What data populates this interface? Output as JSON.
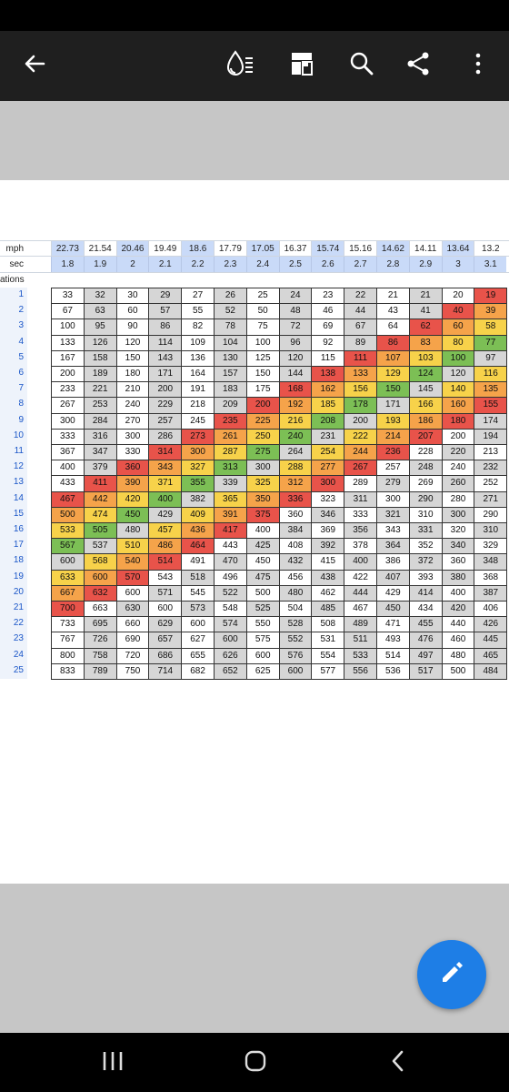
{
  "app": {
    "toolbar": {
      "back_icon": "arrow-left-icon",
      "icons": [
        "ink-dropper-icon",
        "page-layout-icon",
        "search-icon",
        "share-icon",
        "more-vert-icon"
      ]
    },
    "fab_icon": "pencil-icon",
    "nav": [
      "recent-apps-icon",
      "home-icon",
      "back-chevron-icon"
    ]
  },
  "sheet": {
    "label_mph": "mph",
    "label_sec": "sec",
    "label_rows": "ations",
    "mph": [
      "22.73",
      "21.54",
      "20.46",
      "19.49",
      "18.6",
      "17.79",
      "17.05",
      "16.37",
      "15.74",
      "15.16",
      "14.62",
      "14.11",
      "13.64",
      "13.2"
    ],
    "sec": [
      "1.8",
      "1.9",
      "2",
      "2.1",
      "2.2",
      "2.3",
      "2.4",
      "2.5",
      "2.6",
      "2.7",
      "2.8",
      "2.9",
      "3",
      "3.1"
    ],
    "row_numbers": [
      "1",
      "2",
      "3",
      "4",
      "5",
      "6",
      "7",
      "8",
      "9",
      "10",
      "11",
      "12",
      "13",
      "14",
      "15",
      "16",
      "17",
      "18",
      "19",
      "20",
      "21",
      "22",
      "23",
      "24",
      "25"
    ],
    "rows": [
      [
        "33",
        "32",
        "30",
        "29",
        "27",
        "26",
        "25",
        "24",
        "23",
        "22",
        "21",
        "21",
        "20",
        "19"
      ],
      [
        "67",
        "63",
        "60",
        "57",
        "55",
        "52",
        "50",
        "48",
        "46",
        "44",
        "43",
        "41",
        "40",
        "39"
      ],
      [
        "100",
        "95",
        "90",
        "86",
        "82",
        "78",
        "75",
        "72",
        "69",
        "67",
        "64",
        "62",
        "60",
        "58"
      ],
      [
        "133",
        "126",
        "120",
        "114",
        "109",
        "104",
        "100",
        "96",
        "92",
        "89",
        "86",
        "83",
        "80",
        "77"
      ],
      [
        "167",
        "158",
        "150",
        "143",
        "136",
        "130",
        "125",
        "120",
        "115",
        "111",
        "107",
        "103",
        "100",
        "97"
      ],
      [
        "200",
        "189",
        "180",
        "171",
        "164",
        "157",
        "150",
        "144",
        "138",
        "133",
        "129",
        "124",
        "120",
        "116"
      ],
      [
        "233",
        "221",
        "210",
        "200",
        "191",
        "183",
        "175",
        "168",
        "162",
        "156",
        "150",
        "145",
        "140",
        "135"
      ],
      [
        "267",
        "253",
        "240",
        "229",
        "218",
        "209",
        "200",
        "192",
        "185",
        "178",
        "171",
        "166",
        "160",
        "155"
      ],
      [
        "300",
        "284",
        "270",
        "257",
        "245",
        "235",
        "225",
        "216",
        "208",
        "200",
        "193",
        "186",
        "180",
        "174"
      ],
      [
        "333",
        "316",
        "300",
        "286",
        "273",
        "261",
        "250",
        "240",
        "231",
        "222",
        "214",
        "207",
        "200",
        "194"
      ],
      [
        "367",
        "347",
        "330",
        "314",
        "300",
        "287",
        "275",
        "264",
        "254",
        "244",
        "236",
        "228",
        "220",
        "213"
      ],
      [
        "400",
        "379",
        "360",
        "343",
        "327",
        "313",
        "300",
        "288",
        "277",
        "267",
        "257",
        "248",
        "240",
        "232"
      ],
      [
        "433",
        "411",
        "390",
        "371",
        "355",
        "339",
        "325",
        "312",
        "300",
        "289",
        "279",
        "269",
        "260",
        "252"
      ],
      [
        "467",
        "442",
        "420",
        "400",
        "382",
        "365",
        "350",
        "336",
        "323",
        "311",
        "300",
        "290",
        "280",
        "271"
      ],
      [
        "500",
        "474",
        "450",
        "429",
        "409",
        "391",
        "375",
        "360",
        "346",
        "333",
        "321",
        "310",
        "300",
        "290"
      ],
      [
        "533",
        "505",
        "480",
        "457",
        "436",
        "417",
        "400",
        "384",
        "369",
        "356",
        "343",
        "331",
        "320",
        "310"
      ],
      [
        "567",
        "537",
        "510",
        "486",
        "464",
        "443",
        "425",
        "408",
        "392",
        "378",
        "364",
        "352",
        "340",
        "329"
      ],
      [
        "600",
        "568",
        "540",
        "514",
        "491",
        "470",
        "450",
        "432",
        "415",
        "400",
        "386",
        "372",
        "360",
        "348"
      ],
      [
        "633",
        "600",
        "570",
        "543",
        "518",
        "496",
        "475",
        "456",
        "438",
        "422",
        "407",
        "393",
        "380",
        "368"
      ],
      [
        "667",
        "632",
        "600",
        "571",
        "545",
        "522",
        "500",
        "480",
        "462",
        "444",
        "429",
        "414",
        "400",
        "387"
      ],
      [
        "700",
        "663",
        "630",
        "600",
        "573",
        "548",
        "525",
        "504",
        "485",
        "467",
        "450",
        "434",
        "420",
        "406"
      ],
      [
        "733",
        "695",
        "660",
        "629",
        "600",
        "574",
        "550",
        "528",
        "508",
        "489",
        "471",
        "455",
        "440",
        "426"
      ],
      [
        "767",
        "726",
        "690",
        "657",
        "627",
        "600",
        "575",
        "552",
        "531",
        "511",
        "493",
        "476",
        "460",
        "445"
      ],
      [
        "800",
        "758",
        "720",
        "686",
        "655",
        "626",
        "600",
        "576",
        "554",
        "533",
        "514",
        "497",
        "480",
        "465"
      ],
      [
        "833",
        "789",
        "750",
        "714",
        "682",
        "652",
        "625",
        "600",
        "577",
        "556",
        "536",
        "517",
        "500",
        "484"
      ]
    ],
    "colors": {
      "red": "#e8534a",
      "orange": "#f5a34a",
      "yellow": "#f7d24a",
      "green": "#7cbf55",
      "gray": "#d6d6d6",
      "white": "#ffffff",
      "header_blue": "#c9daf8",
      "header_white": "#ffffff"
    },
    "cell_colors": [
      [
        "white",
        "gray",
        "white",
        "gray",
        "white",
        "gray",
        "white",
        "gray",
        "white",
        "gray",
        "white",
        "gray",
        "white",
        "red"
      ],
      [
        "white",
        "gray",
        "white",
        "gray",
        "white",
        "gray",
        "white",
        "gray",
        "white",
        "gray",
        "white",
        "gray",
        "red",
        "orange"
      ],
      [
        "white",
        "gray",
        "white",
        "gray",
        "white",
        "gray",
        "white",
        "gray",
        "white",
        "gray",
        "white",
        "red",
        "orange",
        "yellow"
      ],
      [
        "white",
        "gray",
        "white",
        "gray",
        "white",
        "gray",
        "white",
        "gray",
        "white",
        "gray",
        "red",
        "orange",
        "yellow",
        "green"
      ],
      [
        "white",
        "gray",
        "white",
        "gray",
        "white",
        "gray",
        "white",
        "gray",
        "white",
        "red",
        "orange",
        "yellow",
        "green",
        "gray"
      ],
      [
        "white",
        "gray",
        "white",
        "gray",
        "white",
        "gray",
        "white",
        "gray",
        "red",
        "orange",
        "yellow",
        "green",
        "gray",
        "yellow"
      ],
      [
        "white",
        "gray",
        "white",
        "gray",
        "white",
        "gray",
        "white",
        "red",
        "orange",
        "yellow",
        "green",
        "gray",
        "yellow",
        "orange"
      ],
      [
        "white",
        "gray",
        "white",
        "gray",
        "white",
        "gray",
        "red",
        "orange",
        "yellow",
        "green",
        "gray",
        "yellow",
        "orange",
        "red"
      ],
      [
        "white",
        "gray",
        "white",
        "gray",
        "white",
        "red",
        "orange",
        "yellow",
        "green",
        "gray",
        "yellow",
        "orange",
        "red",
        "gray"
      ],
      [
        "white",
        "gray",
        "white",
        "gray",
        "red",
        "orange",
        "yellow",
        "green",
        "gray",
        "yellow",
        "orange",
        "red",
        "white",
        "gray"
      ],
      [
        "white",
        "gray",
        "white",
        "red",
        "orange",
        "yellow",
        "green",
        "gray",
        "yellow",
        "orange",
        "red",
        "white",
        "gray",
        "white"
      ],
      [
        "white",
        "gray",
        "red",
        "orange",
        "yellow",
        "green",
        "gray",
        "yellow",
        "orange",
        "red",
        "white",
        "gray",
        "white",
        "gray"
      ],
      [
        "white",
        "red",
        "orange",
        "yellow",
        "green",
        "gray",
        "yellow",
        "orange",
        "red",
        "white",
        "gray",
        "white",
        "gray",
        "white"
      ],
      [
        "red",
        "orange",
        "yellow",
        "green",
        "gray",
        "yellow",
        "orange",
        "red",
        "white",
        "gray",
        "white",
        "gray",
        "white",
        "gray"
      ],
      [
        "orange",
        "yellow",
        "green",
        "gray",
        "yellow",
        "orange",
        "red",
        "white",
        "gray",
        "white",
        "gray",
        "white",
        "gray",
        "white"
      ],
      [
        "yellow",
        "green",
        "gray",
        "yellow",
        "orange",
        "red",
        "white",
        "gray",
        "white",
        "gray",
        "white",
        "gray",
        "white",
        "gray"
      ],
      [
        "green",
        "gray",
        "yellow",
        "orange",
        "red",
        "white",
        "gray",
        "white",
        "gray",
        "white",
        "gray",
        "white",
        "gray",
        "white"
      ],
      [
        "gray",
        "yellow",
        "orange",
        "red",
        "white",
        "gray",
        "white",
        "gray",
        "white",
        "gray",
        "white",
        "gray",
        "white",
        "gray"
      ],
      [
        "yellow",
        "orange",
        "red",
        "white",
        "gray",
        "white",
        "gray",
        "white",
        "gray",
        "white",
        "gray",
        "white",
        "gray",
        "white"
      ],
      [
        "orange",
        "red",
        "white",
        "gray",
        "white",
        "gray",
        "white",
        "gray",
        "white",
        "gray",
        "white",
        "gray",
        "white",
        "gray"
      ],
      [
        "red",
        "white",
        "gray",
        "white",
        "gray",
        "white",
        "gray",
        "white",
        "gray",
        "white",
        "gray",
        "white",
        "gray",
        "white"
      ],
      [
        "white",
        "gray",
        "white",
        "gray",
        "white",
        "gray",
        "white",
        "gray",
        "white",
        "gray",
        "white",
        "gray",
        "white",
        "gray"
      ],
      [
        "white",
        "gray",
        "white",
        "gray",
        "white",
        "gray",
        "white",
        "gray",
        "white",
        "gray",
        "white",
        "gray",
        "white",
        "gray"
      ],
      [
        "white",
        "gray",
        "white",
        "gray",
        "white",
        "gray",
        "white",
        "gray",
        "white",
        "gray",
        "white",
        "gray",
        "white",
        "gray"
      ],
      [
        "white",
        "gray",
        "white",
        "gray",
        "white",
        "gray",
        "white",
        "gray",
        "white",
        "gray",
        "white",
        "gray",
        "white",
        "gray"
      ]
    ]
  }
}
